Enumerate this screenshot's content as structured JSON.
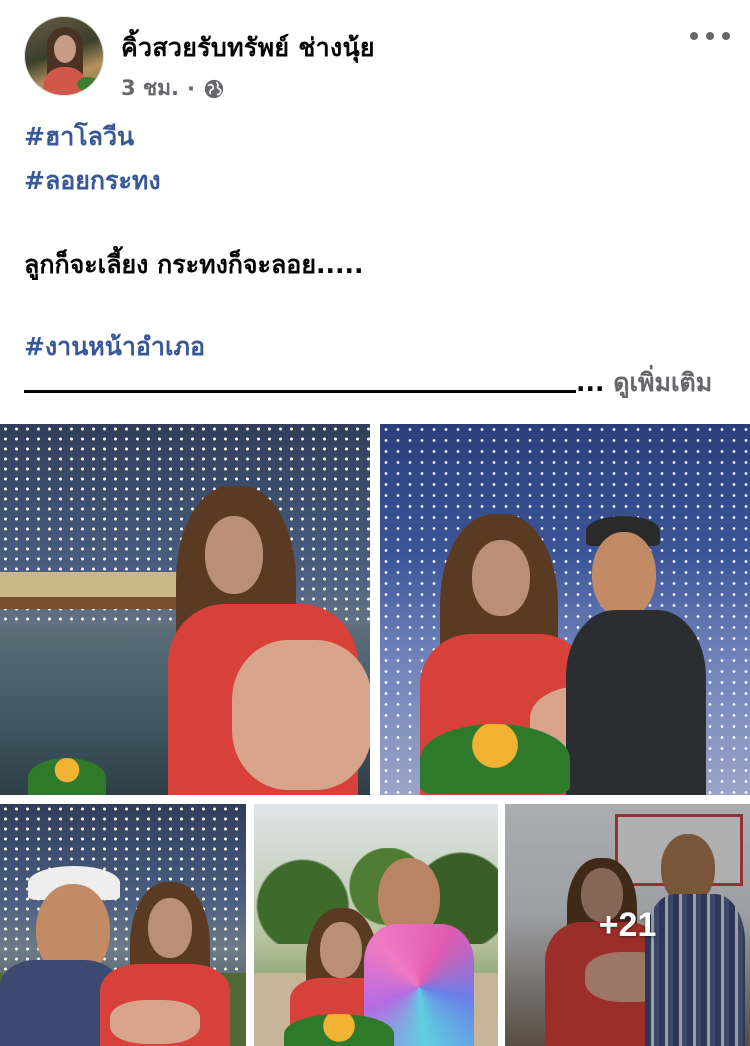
{
  "post": {
    "author": "คิ้วสวยรับทรัพย์ ช่างนุ้ย",
    "time": "3 ชม.",
    "separator": "·",
    "privacy_icon": "globe-icon",
    "more_icon": "more-options-icon"
  },
  "caption": {
    "hashtag_1": "#ฮาโลวีน",
    "hashtag_2": "#ลอยกระทง",
    "body": "ลูกก็จะเลี้ยง กระทงก็จะลอย.....",
    "hashtag_3": "#งานหน้าอำเภอ",
    "ellipsis": "...",
    "see_more": "ดูเพิ่มเติม"
  },
  "photos": {
    "more_count": "+21"
  },
  "colors": {
    "hashtag": "#385898",
    "meta": "#65676b",
    "text": "#050505"
  }
}
